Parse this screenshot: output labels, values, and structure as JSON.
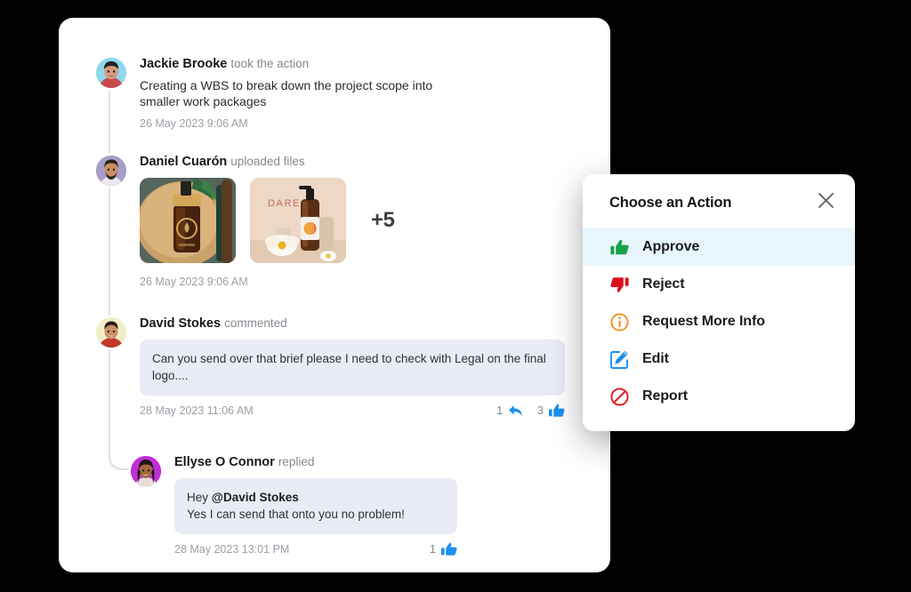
{
  "feed": {
    "events": [
      {
        "id": "jackie-action",
        "name": "Jackie Brooke",
        "verb": "took the action",
        "text": "Creating a WBS to break down the project scope into smaller work packages",
        "time": "26 May 2023 9:06 AM",
        "avatar_bg": "#8fd8ec"
      },
      {
        "id": "daniel-upload",
        "name": "Daniel Cuarón",
        "verb": "uploaded files",
        "time": "26 May 2023 9:06 AM",
        "avatar_bg": "#a79ec9",
        "more_count": "+5",
        "attachments": [
          {
            "name": "oil-dropper-bottle-photo",
            "alt": "Amber dropper bottle on wooden board with palm leaf"
          },
          {
            "name": "dare-pump-bottle-photo",
            "alt": "DARE branded pump bottle with orchid and soap bars"
          }
        ]
      },
      {
        "id": "david-comment",
        "name": "David Stokes",
        "verb": "commented",
        "time": "28 May 2023 11:06 AM",
        "avatar_bg": "#efeec8",
        "comment": "Can you send over that brief please I need to  check with Legal on the final logo....",
        "reply_count": "1",
        "like_count": "3"
      },
      {
        "id": "ellyse-reply",
        "name": "Ellyse O Connor",
        "verb": "replied",
        "time": "28 May 2023 13:01 PM",
        "avatar_bg": "#c12ed6",
        "reply_greeting": "Hey",
        "reply_mention": "@David Stokes",
        "reply_text": "Yes I can send that onto you no problem!",
        "like_count": "1"
      }
    ]
  },
  "action_panel": {
    "title": "Choose an Action",
    "close_icon": "close-icon",
    "items": [
      {
        "label": "Approve",
        "icon": "thumbs-up-icon",
        "color": "#16a34a",
        "active": true
      },
      {
        "label": "Reject",
        "icon": "thumbs-down-icon",
        "color": "#dc0f1e",
        "active": false
      },
      {
        "label": "Request More Info",
        "icon": "info-circle-icon",
        "color": "#f2870d",
        "active": false
      },
      {
        "label": "Edit",
        "icon": "edit-square-icon",
        "color": "#1a90f0",
        "active": false
      },
      {
        "label": "Report",
        "icon": "ban-circle-icon",
        "color": "#e3161f",
        "active": false
      }
    ]
  },
  "colors": {
    "accent_blue": "#1a90f0",
    "bubble_bg": "#e9ecf5",
    "highlight_bg": "#e7f5fd",
    "card_bg": "#ffffff",
    "page_bg": "#000000"
  }
}
